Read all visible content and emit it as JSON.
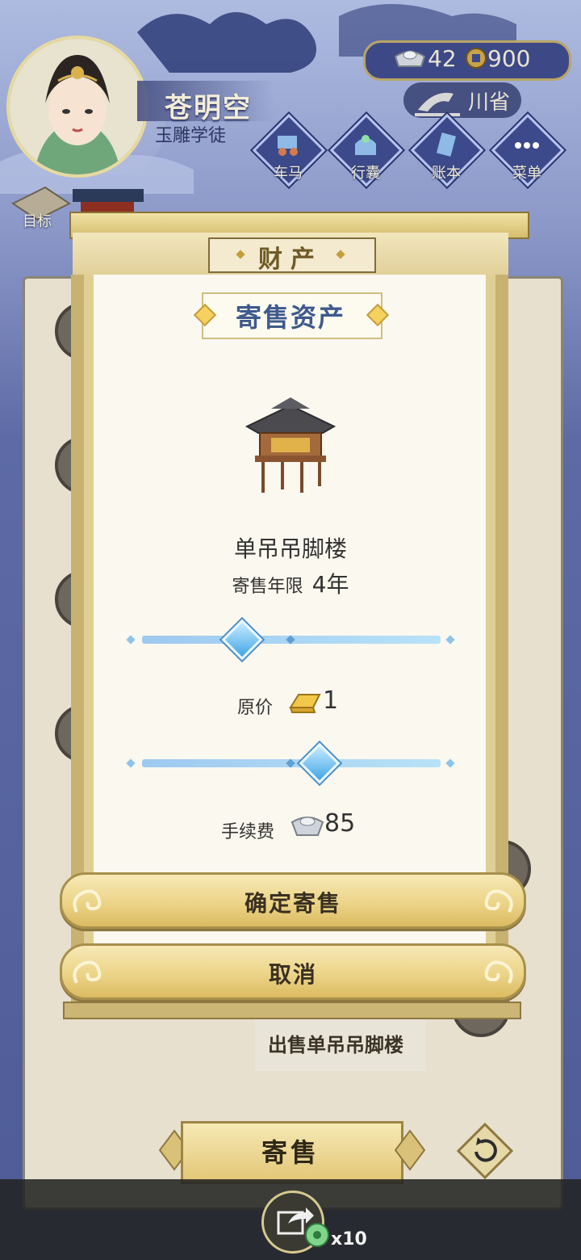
{
  "player": {
    "name": "苍明空",
    "title": "玉雕学徒"
  },
  "currency": {
    "silver": "42",
    "copper": "900"
  },
  "location": {
    "province": "川省"
  },
  "nav": [
    {
      "label": "车马",
      "icon": "carriage-icon"
    },
    {
      "label": "行囊",
      "icon": "bag-icon"
    },
    {
      "label": "账本",
      "icon": "ledger-icon"
    },
    {
      "label": "菜单",
      "icon": "menu-dots-icon"
    }
  ],
  "goal": {
    "label": "目标"
  },
  "modal": {
    "header": "财产",
    "subtitle": "寄售资产",
    "asset_name": "单吊吊脚楼",
    "term_label": "寄售年限",
    "term_value": "4年",
    "term_slider": {
      "value": 4,
      "steps": [
        "",
        "",
        ""
      ]
    },
    "price_label": "原价",
    "price_value": "1",
    "price_slider": {
      "value": 1
    },
    "fee_label": "手续费",
    "fee_value": "85",
    "confirm_label": "确定寄售",
    "cancel_label": "取消"
  },
  "background_panel": {
    "sell_label": "出售单吊吊脚楼",
    "consign_label": "寄售"
  },
  "bottom": {
    "share_count": "x10"
  },
  "colors": {
    "accent_blue": "#3f5a8c",
    "gold": "#e3c676",
    "panel": "#fbf8ef"
  }
}
